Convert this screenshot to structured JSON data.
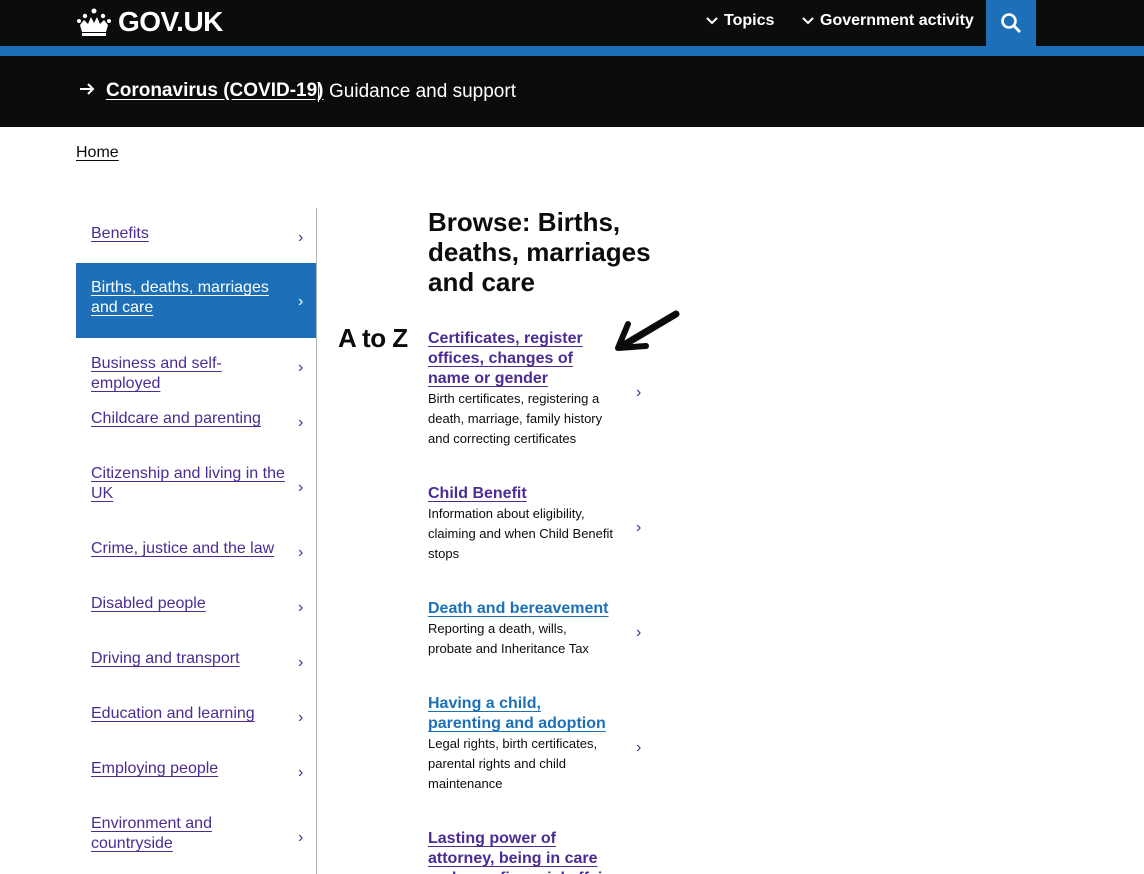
{
  "header": {
    "logo_text": "GOV.UK",
    "nav": [
      {
        "label": "Topics"
      },
      {
        "label": "Government activity"
      }
    ],
    "icons": {
      "logo": "crown-icon",
      "search": "search-icon",
      "chevron": "chevron-down-icon"
    },
    "colors": {
      "header_bg": "#0b0c0c",
      "accent": "#1d70b8"
    }
  },
  "covid_banner": {
    "link": "Coronavirus (COVID-19)",
    "subtitle": "Guidance and support",
    "icon": "arrow-right-icon"
  },
  "breadcrumb": {
    "home": "Home"
  },
  "sidebar": {
    "items": [
      {
        "label": "Benefits",
        "active": false
      },
      {
        "label": "Births, deaths, marriages and care",
        "active": true
      },
      {
        "label": "Business and self-employed",
        "active": false
      },
      {
        "label": "Childcare and parenting",
        "active": false
      },
      {
        "label": "Citizenship and living in the UK",
        "active": false
      },
      {
        "label": "Crime, justice and the law",
        "active": false
      },
      {
        "label": "Disabled people",
        "active": false
      },
      {
        "label": "Driving and transport",
        "active": false
      },
      {
        "label": "Education and learning",
        "active": false
      },
      {
        "label": "Employing people",
        "active": false
      },
      {
        "label": "Environment and countryside",
        "active": false
      }
    ],
    "chevron": "›",
    "active_color": "#1d70b8",
    "link_color": "#4c2c92"
  },
  "atoz": "A to Z",
  "main": {
    "title": "Browse: Births, deaths, marriages and care",
    "topics": [
      {
        "title": "Certificates, register offices, changes of name or gender",
        "description": "Birth certificates, registering a death, marriage, family history and correcting certificates",
        "visited": true
      },
      {
        "title": "Child Benefit",
        "description": "Information about eligibility, claiming and when Child Benefit stops",
        "visited": true
      },
      {
        "title": "Death and bereavement",
        "description": "Reporting a death, wills, probate and Inheritance Tax",
        "visited": false
      },
      {
        "title": "Having a child, parenting and adoption",
        "description": "Legal rights, birth certificates, parental rights and child maintenance",
        "visited": false
      },
      {
        "title": "Lasting power of attorney, being in care and your financial affairs",
        "description": "",
        "visited": true
      }
    ],
    "chevron": "›"
  },
  "annotation": {
    "icon": "pointer-arrow-icon"
  }
}
